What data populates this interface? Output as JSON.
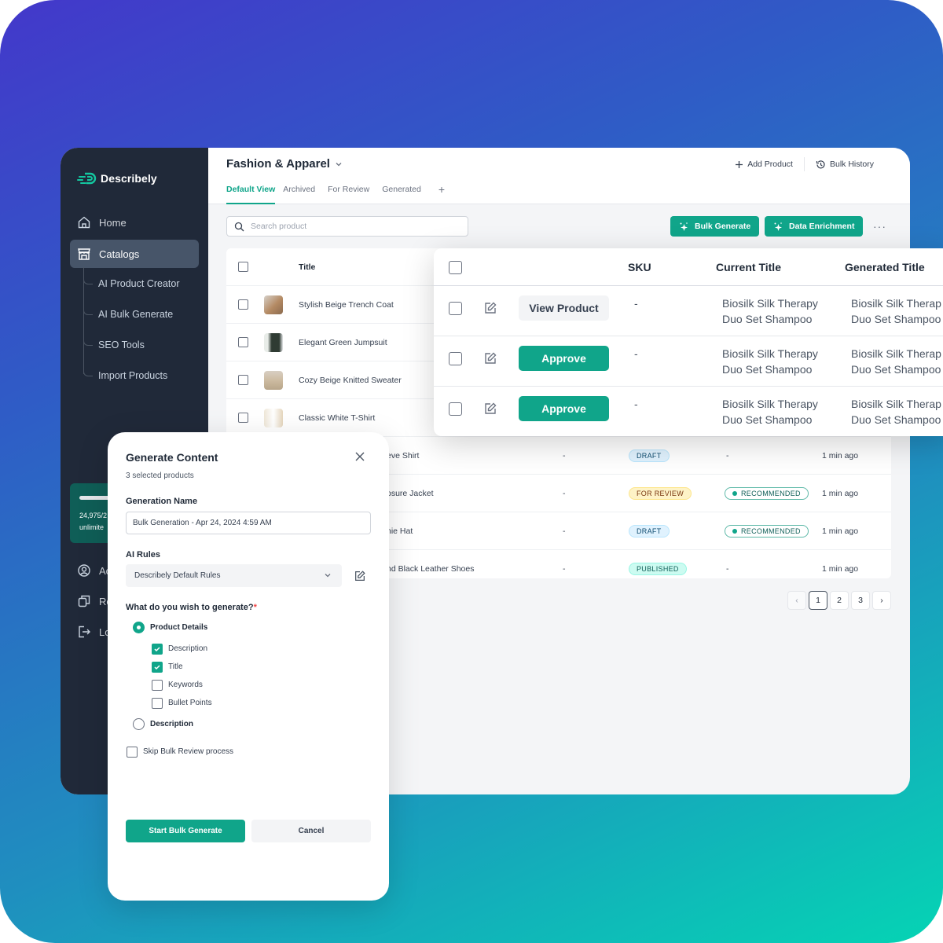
{
  "brand": {
    "name": "Describely",
    "accent": "#10a58a",
    "sidebar_bg": "#202939"
  },
  "sidebar": {
    "items": [
      {
        "label": "Home",
        "icon": "home-icon",
        "active": false
      },
      {
        "label": "Catalogs",
        "icon": "store-icon",
        "active": true
      }
    ],
    "sub_items": [
      "AI Product Creator",
      "AI Bulk Generate",
      "SEO Tools",
      "Import Products"
    ],
    "credits": {
      "text": "24,975/2",
      "subtext": "unlimite",
      "fill": 0.99
    },
    "bottom_items": [
      {
        "label": "Ac",
        "icon": "account-icon"
      },
      {
        "label": "Re",
        "icon": "copy-icon"
      },
      {
        "label": "Lo",
        "icon": "logout-icon"
      }
    ]
  },
  "header": {
    "catalog_title": "Fashion & Apparel",
    "add_product": "Add Product",
    "bulk_history": "Bulk History",
    "tabs": [
      {
        "label": "Default View",
        "active": true
      },
      {
        "label": "Archived",
        "active": false
      },
      {
        "label": "For Review",
        "active": false
      },
      {
        "label": "Generated",
        "active": false
      }
    ],
    "add_tab": "+"
  },
  "toolbar": {
    "search_placeholder": "Search product",
    "bulk_generate": "Bulk Generate",
    "data_enrichment": "Data Enrichment",
    "more": "···"
  },
  "products_table": {
    "title_header": "Title",
    "rows": [
      {
        "title": "Stylish Beige Trench Coat",
        "thumb_color": "#b48a63"
      },
      {
        "title": "Elegant Green Jumpsuit",
        "thumb_color": "#2f3b33"
      },
      {
        "title": "Cozy Beige Knitted Sweater",
        "thumb_color": "#cdbba1"
      },
      {
        "title": "Classic White T-Shirt",
        "thumb_color": "#ece7de"
      },
      {
        "title": "eve Shirt",
        "sku": "-",
        "status": "DRAFT",
        "status_type": "draft",
        "rec": "-",
        "updated": "1 min ago"
      },
      {
        "title": "osure Jacket",
        "sku": "-",
        "status": "FOR REVIEW",
        "status_type": "review",
        "rec": "RECOMMENDED",
        "updated": "1 min ago"
      },
      {
        "title": "nie Hat",
        "sku": "-",
        "status": "DRAFT",
        "status_type": "draft",
        "rec": "RECOMMENDED",
        "updated": "1 min ago"
      },
      {
        "title": "nd Black Leather Shoes",
        "sku": "-",
        "status": "PUBLISHED",
        "status_type": "published",
        "rec": "-",
        "updated": "1 min ago"
      }
    ]
  },
  "pagination": {
    "pages": [
      "1",
      "2",
      "3"
    ],
    "current": "1",
    "prev": "‹",
    "next": "›"
  },
  "review_card": {
    "headers": {
      "sku": "SKU",
      "current_title": "Current Title",
      "generated_title": "Generated Title"
    },
    "rows": [
      {
        "action": "View Product",
        "action_type": "view",
        "sku": "-",
        "current_title": [
          "Biosilk Silk Therapy",
          "Duo Set Shampoo"
        ],
        "generated_title": [
          "Biosilk Silk Therap",
          "Duo Set Shampoo"
        ]
      },
      {
        "action": "Approve",
        "action_type": "approve",
        "sku": "-",
        "current_title": [
          "Biosilk Silk Therapy",
          "Duo Set Shampoo"
        ],
        "generated_title": [
          "Biosilk Silk Therap",
          "Duo Set Shampoo"
        ]
      },
      {
        "action": "Approve",
        "action_type": "approve",
        "sku": "-",
        "current_title": [
          "Biosilk Silk Therapy",
          "Duo Set Shampoo"
        ],
        "generated_title": [
          "Biosilk Silk Therap",
          "Duo Set Shampoo"
        ]
      }
    ]
  },
  "modal": {
    "title": "Generate Content",
    "subtitle": "3 selected products",
    "generation_name_label": "Generation Name",
    "generation_name_value": "Bulk Generation - Apr 24, 2024 4:59 AM",
    "ai_rules_label": "AI Rules",
    "ai_rules_value": "Describely Default Rules",
    "question": "What do you wish to generate?",
    "required_mark": "*",
    "radio_product_details": "Product Details",
    "radio_description": "Description",
    "checkboxes": [
      {
        "label": "Description",
        "checked": true
      },
      {
        "label": "Title",
        "checked": true
      },
      {
        "label": "Keywords",
        "checked": false
      },
      {
        "label": "Bullet Points",
        "checked": false
      }
    ],
    "skip_review": "Skip Bulk Review process",
    "skip_review_checked": false,
    "start_button": "Start Bulk Generate",
    "cancel_button": "Cancel"
  }
}
